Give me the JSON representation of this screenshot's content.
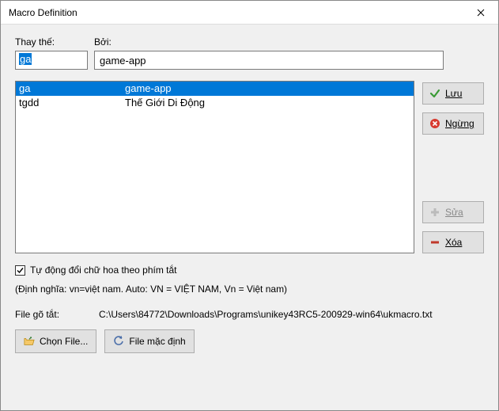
{
  "window": {
    "title": "Macro Definition"
  },
  "labels": {
    "replace": "Thay thế:",
    "with": "Bởi:",
    "auto_case": "Tự động đổi chữ hoa theo phím tắt",
    "hint": "(Định nghĩa: vn=việt nam. Auto: VN = VIỆT NAM, Vn = Việt nam)",
    "file_label": "File gõ tắt:"
  },
  "inputs": {
    "replace_value": "ga",
    "with_value": "game-app"
  },
  "macros": [
    {
      "key": "ga",
      "value": "game-app",
      "selected": true
    },
    {
      "key": "tgdd",
      "value": "Thế Giới Di Động",
      "selected": false
    }
  ],
  "buttons": {
    "save": "Lưu",
    "stop": "Ngừng",
    "edit": "Sửa",
    "delete": "Xóa",
    "choose_file": "Chọn File...",
    "default_file": "File mặc định"
  },
  "file_path": "C:\\Users\\84772\\Downloads\\Programs\\unikey43RC5-200929-win64\\ukmacro.txt",
  "checkbox_checked": true
}
